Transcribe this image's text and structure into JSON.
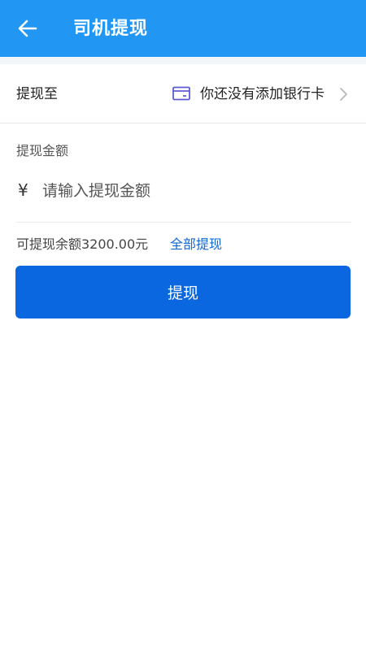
{
  "header": {
    "title": "司机提现",
    "background_color": "#2196f3",
    "back_icon": "arrow-left-icon"
  },
  "withdraw_to": {
    "label": "提现至",
    "bank_card_text": "你还没有添加银行卡",
    "bank_card_icon": "bank-card-icon",
    "bank_card_icon_color": "#5b5bd6",
    "chevron_icon": "chevron-right-icon"
  },
  "amount": {
    "label": "提现金额",
    "currency_symbol": "¥",
    "placeholder": "请输入提现金额",
    "value": ""
  },
  "balance": {
    "text": "可提现余额3200.00元",
    "withdraw_all_label": "全部提现",
    "link_color": "#1067d4"
  },
  "submit": {
    "label": "提现",
    "color": "#0b67e0"
  }
}
